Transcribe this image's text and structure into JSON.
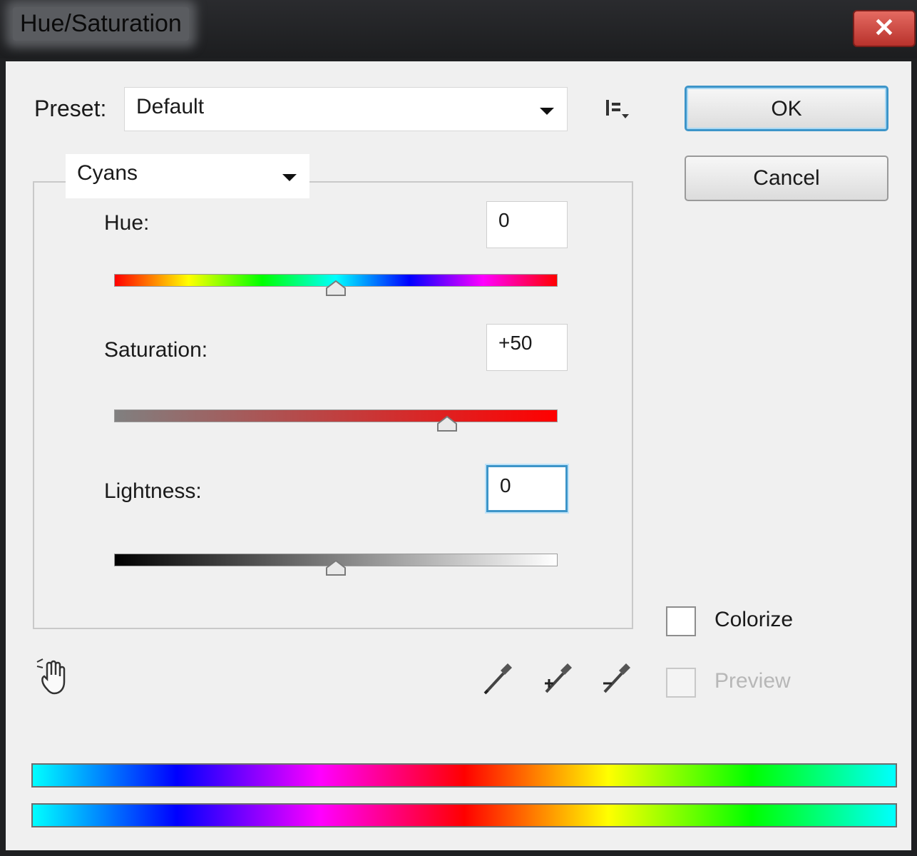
{
  "window": {
    "title": "Hue/Saturation",
    "close_glyph": "✕"
  },
  "preset": {
    "label": "Preset:",
    "value": "Default"
  },
  "buttons": {
    "ok": "OK",
    "cancel": "Cancel"
  },
  "channel": {
    "value": "Cyans"
  },
  "adjustments": {
    "hue": {
      "label": "Hue:",
      "value": "0",
      "level": 0.5
    },
    "saturation": {
      "label": "Saturation:",
      "value": "+50",
      "level": 0.75
    },
    "lightness": {
      "label": "Lightness:",
      "value": "0",
      "level": 0.5
    }
  },
  "options": {
    "colorize": {
      "label": "Colorize",
      "checked": false
    },
    "preview": {
      "label": "Preview",
      "checked": false,
      "enabled": false
    }
  },
  "icons": {
    "preset_options": "preset-options-icon",
    "targeted_adjustment": "hand-icon",
    "eyedropper": "eyedropper-icon",
    "eyedropper_plus": "eyedropper-plus-icon",
    "eyedropper_minus": "eyedropper-minus-icon"
  },
  "colors": {
    "accent": "#3d95c9",
    "close": "#c8423b",
    "dialog_bg": "#f0f0f0"
  }
}
